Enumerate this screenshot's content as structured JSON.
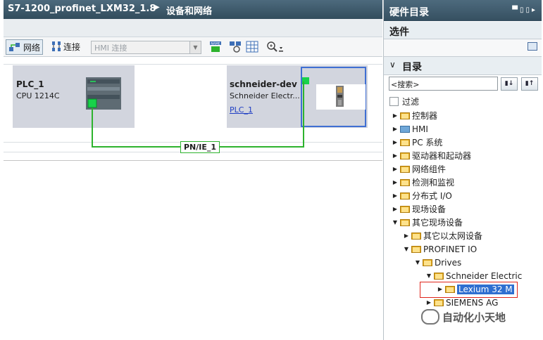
{
  "header": {
    "project": "S7-1200_profinet_LXM32_1.8",
    "separator_icon": "triangle-right-icon",
    "page": "设备和网络"
  },
  "toolbar": {
    "network_label": "网络",
    "connect_label": "连接",
    "connection_type": "HMI 连接"
  },
  "devices": {
    "plc": {
      "name": "PLC_1",
      "type": "CPU 1214C"
    },
    "drive": {
      "name": "schneider-dev",
      "type": "Schneider Electr...",
      "link": "PLC_1"
    }
  },
  "network": {
    "label": "PN/IE_1",
    "color": "#2db32d"
  },
  "catalog": {
    "title": "硬件目录",
    "options_title": "选件",
    "catalog_title": "目录",
    "search_value": "<搜索>",
    "filter_label": "过滤",
    "tree": [
      {
        "label": "控制器",
        "level": 0,
        "expanded": false
      },
      {
        "label": "HMI",
        "level": 0,
        "expanded": false
      },
      {
        "label": "PC 系统",
        "level": 0,
        "expanded": false
      },
      {
        "label": "驱动器和起动器",
        "level": 0,
        "expanded": false
      },
      {
        "label": "网络组件",
        "level": 0,
        "expanded": false
      },
      {
        "label": "检测和监视",
        "level": 0,
        "expanded": false
      },
      {
        "label": "分布式 I/O",
        "level": 0,
        "expanded": false
      },
      {
        "label": "现场设备",
        "level": 0,
        "expanded": false
      },
      {
        "label": "其它现场设备",
        "level": 0,
        "expanded": true
      },
      {
        "label": "其它以太网设备",
        "level": 1,
        "expanded": false
      },
      {
        "label": "PROFINET IO",
        "level": 1,
        "expanded": true
      },
      {
        "label": "Drives",
        "level": 2,
        "expanded": true
      },
      {
        "label": "Schneider Electric",
        "level": 3,
        "expanded": true
      },
      {
        "label": "Lexium 32 M",
        "level": 4,
        "expanded": false,
        "selected": true
      },
      {
        "label": "SIEMENS AG",
        "level": 3,
        "expanded": false
      }
    ]
  },
  "watermark": "自动化小天地",
  "colors": {
    "title_bar": "#3f5a6c",
    "device_box": "#d2d5de",
    "selection": "#2f6fd0",
    "highlight": "#e0251b"
  }
}
